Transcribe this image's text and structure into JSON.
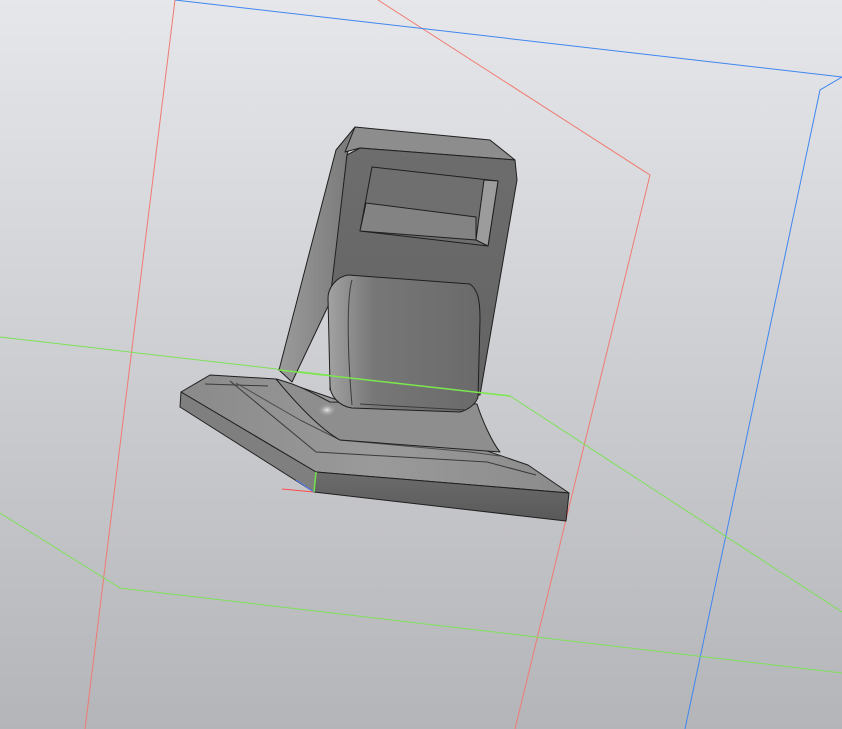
{
  "viewport": {
    "background_top": "#e6e7ea",
    "background_bottom": "#b4b5b9"
  },
  "planes": {
    "front_plane_color": "#f07a72",
    "right_plane_color": "#3f86f0",
    "top_plane_color": "#7ee05a"
  },
  "model": {
    "face_color_light": "#a7a7a7",
    "face_color_mid": "#7b7b7b",
    "face_color_dark": "#5a5a5a",
    "edge_color": "#1f1f1f",
    "selected_edge_color": "#7be84d"
  },
  "triad": {
    "x_axis_color": "#ff4b4b",
    "y_axis_color": "#6ddf4d",
    "z_axis_color": "#4b7bff"
  }
}
